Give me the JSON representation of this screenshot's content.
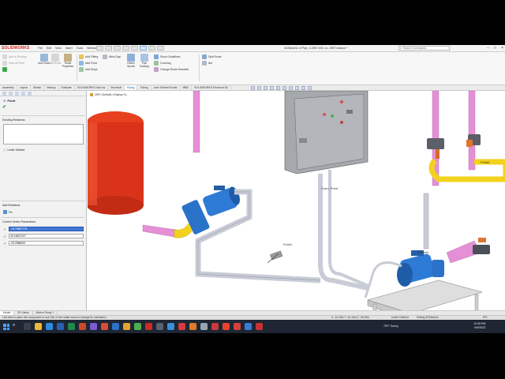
{
  "app": {
    "logo_text": "SOLIDWORKS",
    "document_title": "3DSketch1 of Pipe_3-3997-003 -m- 3997.sldasm *",
    "menus": [
      "File",
      "Edit",
      "View",
      "Insert",
      "Tools",
      "Window"
    ],
    "search_placeholder": "Search Commands"
  },
  "commands": {
    "add_to_routing": "Add to Routing",
    "start_at_point": "Start at Point",
    "auto_route": "Auto Route",
    "edit_route": "Edit Route",
    "route_properties": "Route Properties",
    "add_fitting": "Add Fitting",
    "add_point": "Add Point",
    "add_slope": "Add Slope",
    "weld_gap": "Weld Gap",
    "define_spools": "Define Spools",
    "pipe_drawing": "Pipe Drawing",
    "show_guidelines": "Show Guidelines",
    "covering": "Covering",
    "change_route_diameter": "Change Route Diameter",
    "split_route": "Split Route",
    "line": "line"
  },
  "tabs": [
    "Assembly",
    "Layout",
    "Sketch",
    "Markup",
    "Evaluate",
    "SOLIDWORKS Add-Ins",
    "Electrical",
    "Piping",
    "Tubing",
    "User Defined Route",
    "MBD",
    "SOLIDWORKS Electrical 3D"
  ],
  "active_tab": "Piping",
  "tree_flyout": "3997 (Default) <Display St...",
  "property_manager": {
    "title": "Point",
    "existing_relations_label": "Existing Relations",
    "status": "Under Defined",
    "add_relations_label": "Add Relations",
    "fix_label": "Fix",
    "parameters_label": "Control Vertex Parameters",
    "params": [
      "-76.79887775",
      "40.15537227",
      "-29.2958209"
    ]
  },
  "viewport_labels": {
    "point1": "Point1",
    "point0": "Point0",
    "cpoint": "CPoint1",
    "connection_point": "Conn. Point"
  },
  "model_tabs": [
    "Model",
    "3D Views",
    "Motion Study 1"
  ],
  "active_model_tab": "Model",
  "status_bar": {
    "message": "Left click to place the component or use Tab or the rotate menu to change its orientation",
    "coords": "X -14.18in Y -40.10in Z -26.25in",
    "state": "Under Defined",
    "editing": "Editing 3DSketch1",
    "units": "IPS"
  },
  "taskbar": {
    "weather": "78°F  Sunny",
    "time": "12:09 PM",
    "date": "6/9/2022"
  },
  "colors": {
    "tank": "#e0341c",
    "pump": "#2b72c9",
    "pipe_pink": "#e58fd6",
    "pipe_grey": "#c8ccd6",
    "fitting_yellow": "#f2d21c",
    "panel": "#9fa3a8",
    "accent_blue": "#1a5fb4"
  }
}
